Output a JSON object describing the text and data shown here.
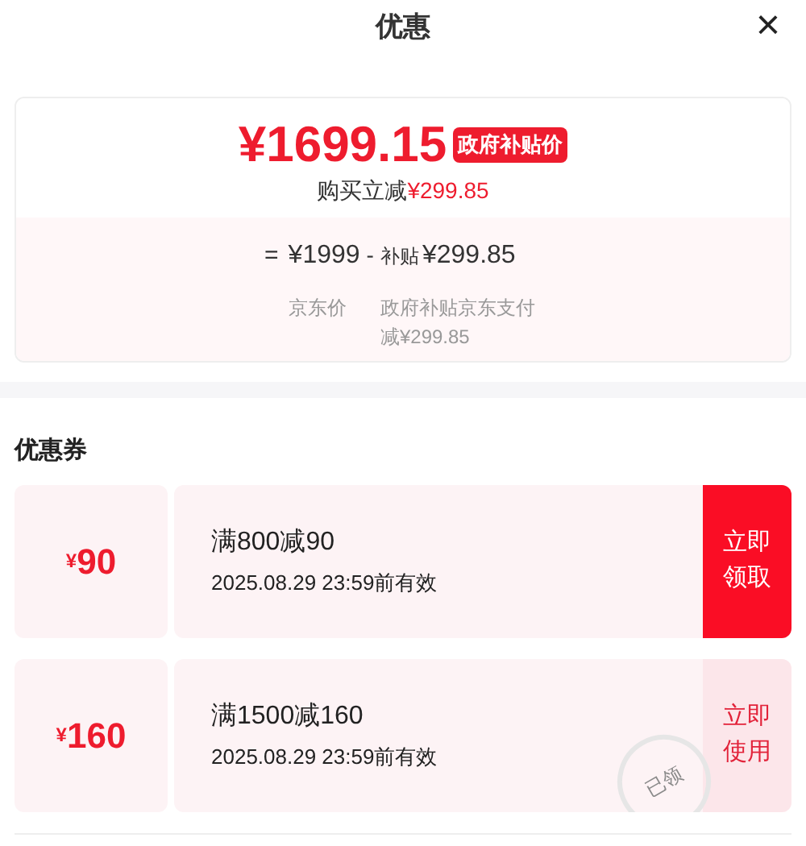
{
  "header": {
    "title": "优惠",
    "close": "×"
  },
  "price": {
    "amount": "¥1699.15",
    "badge": "政府补贴价",
    "saving_label": "购买立减",
    "saving_value": "¥299.85",
    "formula": {
      "equals": "=",
      "base": "¥1999",
      "minus": "-",
      "subsidy_label": "补贴",
      "subsidy_value": "¥299.85",
      "base_caption": "京东价",
      "subsidy_caption": "政府补贴京东支付减¥299.85"
    }
  },
  "coupons": {
    "title": "优惠券",
    "items": [
      {
        "currency": "¥",
        "amount": "90",
        "condition": "满800减90",
        "validity": "2025.08.29 23:59前有效",
        "action": "立即领取",
        "claimed": false
      },
      {
        "currency": "¥",
        "amount": "160",
        "condition": "满1500减160",
        "validity": "2025.08.29 23:59前有效",
        "action": "立即使用",
        "claimed": true,
        "stamp": "已领"
      }
    ]
  }
}
